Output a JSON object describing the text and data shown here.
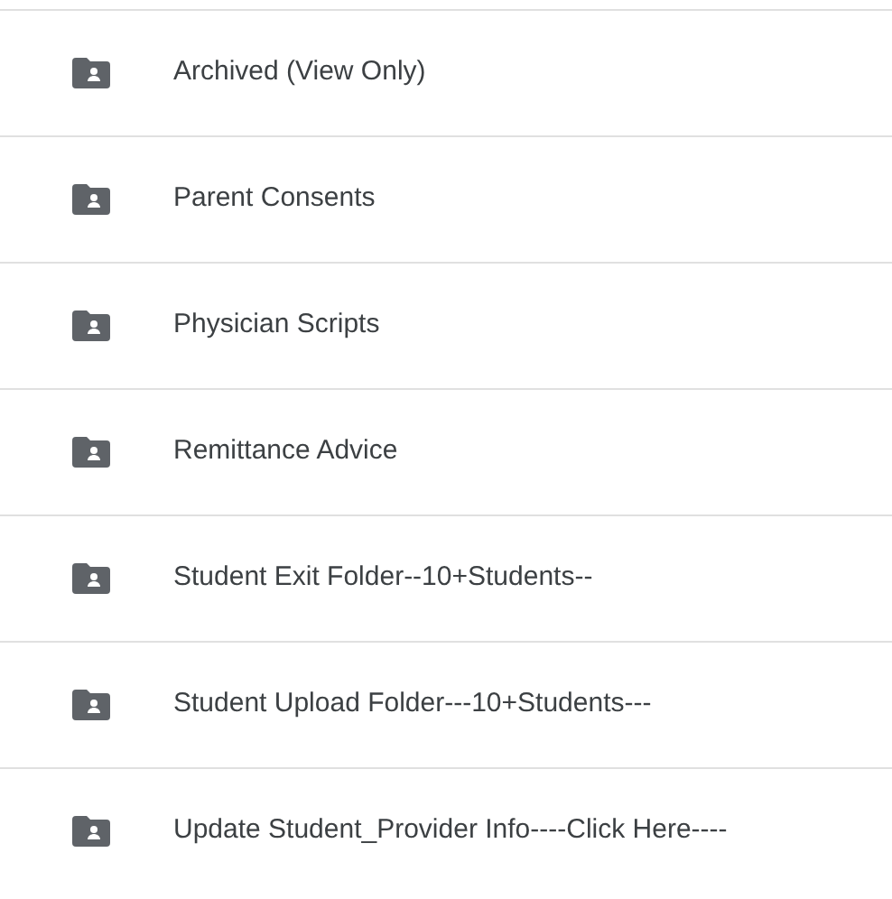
{
  "folders": [
    {
      "name": "Archived (View Only)"
    },
    {
      "name": "Parent Consents"
    },
    {
      "name": "Physician Scripts"
    },
    {
      "name": "Remittance Advice"
    },
    {
      "name": "Student Exit Folder--10+Students--"
    },
    {
      "name": "Student Upload Folder---10+Students---"
    },
    {
      "name": "Update Student_Provider Info----Click Here----"
    }
  ]
}
